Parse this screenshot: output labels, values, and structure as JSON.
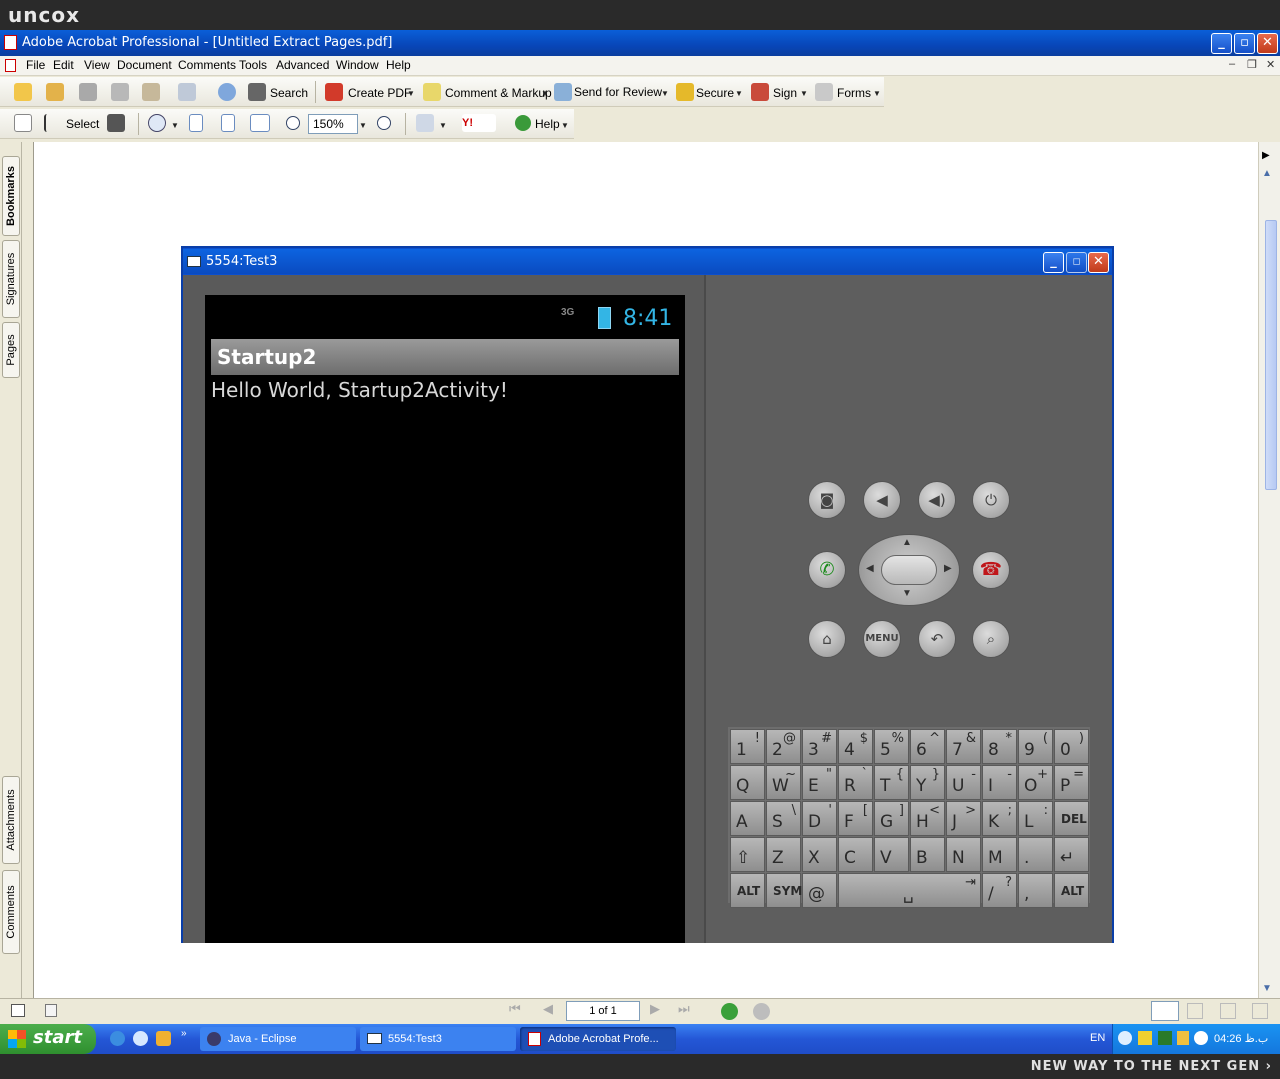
{
  "brand": {
    "logo": "uncox"
  },
  "acrobat": {
    "title": "Adobe Acrobat Professional - [Untitled Extract Pages.pdf]",
    "menu": [
      "File",
      "Edit",
      "View",
      "Document",
      "Comments",
      "Tools",
      "Advanced",
      "Window",
      "Help"
    ],
    "toolbar1": {
      "search_label": "Search",
      "create_pdf_label": "Create PDF",
      "comment_markup_label": "Comment & Markup",
      "send_review_label": "Send for Review",
      "secure_label": "Secure",
      "sign_label": "Sign",
      "forms_label": "Forms"
    },
    "toolbar2": {
      "select_label": "Select",
      "zoom_value": "150%",
      "help_label": "Help"
    },
    "nav_tabs": {
      "bookmarks": "Bookmarks",
      "signatures": "Signatures",
      "pages": "Pages",
      "attachments": "Attachments",
      "comments": "Comments"
    },
    "status": {
      "page_indicator": "1 of 1"
    }
  },
  "emulator": {
    "window_title": "5554:Test3",
    "phone": {
      "network": "3G",
      "clock": "8:41",
      "app_title": "Startup2",
      "content_text": "Hello World, Startup2Activity!"
    },
    "controls": {
      "menu_label": "MENU"
    },
    "keyboard": {
      "row1": [
        [
          "1",
          "!"
        ],
        [
          "2",
          "@"
        ],
        [
          "3",
          "#"
        ],
        [
          "4",
          "$"
        ],
        [
          "5",
          "%"
        ],
        [
          "6",
          "^"
        ],
        [
          "7",
          "&"
        ],
        [
          "8",
          "*"
        ],
        [
          "9",
          "("
        ],
        [
          "0",
          ")"
        ]
      ],
      "row2": [
        [
          "Q",
          ""
        ],
        [
          "W",
          "~"
        ],
        [
          "E",
          "\""
        ],
        [
          "R",
          "`"
        ],
        [
          "T",
          "{"
        ],
        [
          "Y",
          "}"
        ],
        [
          "U",
          "-"
        ],
        [
          "I",
          "-"
        ],
        [
          "O",
          "+"
        ],
        [
          "P",
          "="
        ]
      ],
      "row3": [
        [
          "A",
          ""
        ],
        [
          "S",
          "\\"
        ],
        [
          "D",
          "'"
        ],
        [
          "F",
          "["
        ],
        [
          "G",
          "]"
        ],
        [
          "H",
          "<"
        ],
        [
          "J",
          ">"
        ],
        [
          "K",
          ";"
        ],
        [
          "L",
          ":"
        ],
        [
          "DEL",
          ""
        ]
      ],
      "row4": [
        [
          "⇧",
          ""
        ],
        [
          "Z",
          ""
        ],
        [
          "X",
          ""
        ],
        [
          "C",
          ""
        ],
        [
          "V",
          ""
        ],
        [
          "B",
          ""
        ],
        [
          "N",
          ""
        ],
        [
          "M",
          ""
        ],
        [
          ".",
          ""
        ],
        [
          "↵",
          ""
        ]
      ],
      "row5": {
        "alt_left": "ALT",
        "sym": "SYM",
        "at": "@",
        "slash": "/",
        "question": "?",
        "comma": ",",
        "alt_right": "ALT"
      }
    }
  },
  "taskbar": {
    "start_label": "start",
    "tasks": [
      "Java - Eclipse",
      "5554:Test3",
      "Adobe Acrobat Profe..."
    ],
    "language": "EN",
    "clock": "04:26 ب.ظ"
  },
  "footer": {
    "tagline": "NEW WAY TO THE NEXT GEN ›"
  }
}
